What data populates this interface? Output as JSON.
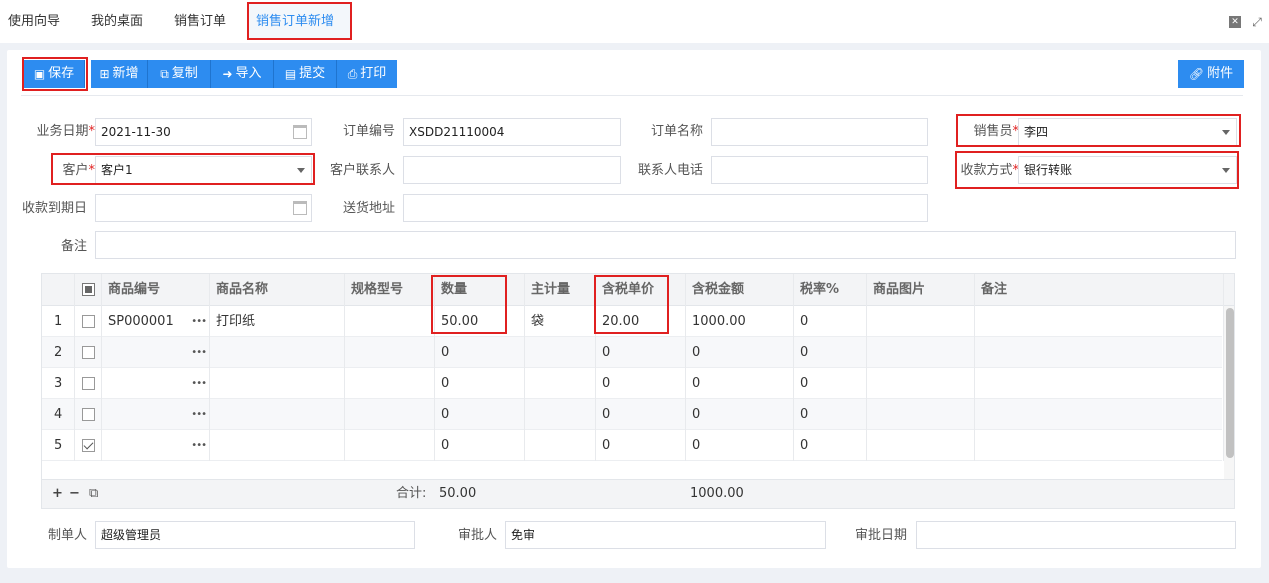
{
  "tabs": [
    "使用向导",
    "我的桌面",
    "销售订单",
    "销售订单新增"
  ],
  "toolbar": {
    "save": "保存",
    "new": "新增",
    "copy": "复制",
    "import": "导入",
    "submit": "提交",
    "print": "打印",
    "attach": "附件"
  },
  "form": {
    "biz_date_label": "业务日期",
    "biz_date": "2021-11-30",
    "order_no_label": "订单编号",
    "order_no": "XSDD21110004",
    "order_name_label": "订单名称",
    "order_name": "",
    "salesman_label": "销售员",
    "salesman": "李四",
    "customer_label": "客户",
    "customer": "客户1",
    "contact_label": "客户联系人",
    "contact": "",
    "phone_label": "联系人电话",
    "phone": "",
    "payment_label": "收款方式",
    "payment": "银行转账",
    "due_label": "收款到期日",
    "due": "",
    "address_label": "送货地址",
    "address": "",
    "remark_label": "备注",
    "remark": "",
    "required_mark": "*"
  },
  "grid": {
    "columns": [
      "商品编号",
      "商品名称",
      "规格型号",
      "数量",
      "主计量",
      "含税单价",
      "含税金额",
      "税率%",
      "商品图片",
      "备注"
    ],
    "rows": [
      {
        "no": "1",
        "code": "SP000001",
        "name": "打印纸",
        "spec": "",
        "qty": "50.00",
        "unit": "袋",
        "price": "20.00",
        "amount": "1000.00",
        "tax": "0",
        "image": "",
        "remark": "",
        "checked": false
      },
      {
        "no": "2",
        "code": "",
        "name": "",
        "spec": "",
        "qty": "0",
        "unit": "",
        "price": "0",
        "amount": "0",
        "tax": "0",
        "image": "",
        "remark": "",
        "checked": false
      },
      {
        "no": "3",
        "code": "",
        "name": "",
        "spec": "",
        "qty": "0",
        "unit": "",
        "price": "0",
        "amount": "0",
        "tax": "0",
        "image": "",
        "remark": "",
        "checked": false
      },
      {
        "no": "4",
        "code": "",
        "name": "",
        "spec": "",
        "qty": "0",
        "unit": "",
        "price": "0",
        "amount": "0",
        "tax": "0",
        "image": "",
        "remark": "",
        "checked": false
      },
      {
        "no": "5",
        "code": "",
        "name": "",
        "spec": "",
        "qty": "0",
        "unit": "",
        "price": "0",
        "amount": "0",
        "tax": "0",
        "image": "",
        "remark": "",
        "checked": true
      }
    ],
    "total_label": "合计:",
    "total_qty": "50.00",
    "total_amount": "1000.00",
    "dots": "•••"
  },
  "footer": {
    "maker_label": "制单人",
    "maker": "超级管理员",
    "approver_label": "审批人",
    "approver": "免审",
    "approve_date_label": "审批日期",
    "approve_date": ""
  },
  "icons": {
    "save": "save-icon",
    "new": "plus-square-icon",
    "copy": "copy-icon",
    "import": "import-icon",
    "submit": "document-icon",
    "print": "print-icon",
    "attach": "link-icon",
    "add_row": "+",
    "remove_row": "−"
  },
  "colors": {
    "primary": "#2d8cf0",
    "highlight": "#e02020"
  }
}
